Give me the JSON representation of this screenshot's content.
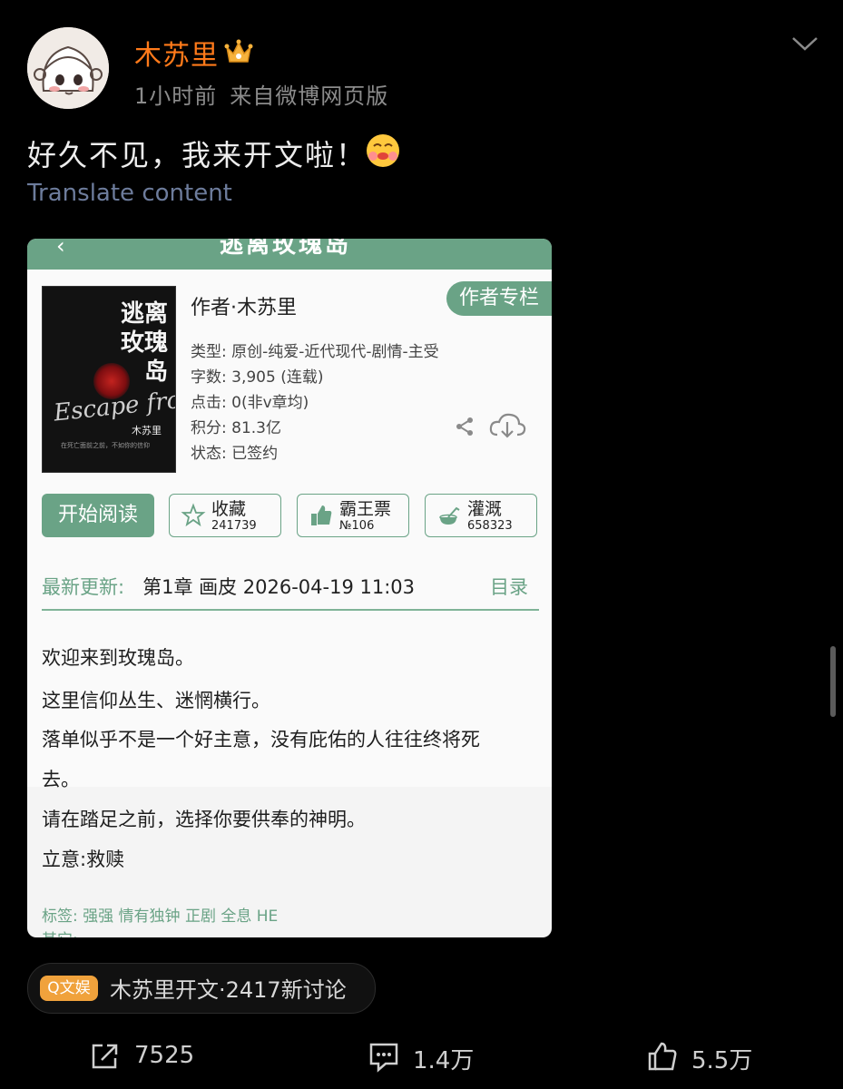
{
  "post": {
    "username": "木苏里",
    "time": "1小时前",
    "source": "来自微博网页版",
    "text": "好久不见，我来开文啦！",
    "translate_label": "Translate content"
  },
  "card": {
    "header_title": "逃离玫瑰岛",
    "cover": {
      "title": "逃离玫瑰岛",
      "script_text": "Escape from",
      "author": "木苏里",
      "tagline": "在死亡面前之前，不如你的信仰"
    },
    "author_line": "作者·木苏里",
    "author_column_button": "作者专栏",
    "details": [
      "类型: 原创-纯爱-近代现代-剧情-主受",
      "字数: 3,905 (连载)",
      "点击: 0(非v章均)",
      "积分: 81.3亿",
      "状态: 已签约"
    ],
    "buttons": {
      "read": "开始阅读",
      "collect": {
        "label": "收藏",
        "count": "241739"
      },
      "vote": {
        "label": "霸王票",
        "count": "№106"
      },
      "irrigate": {
        "label": "灌溉",
        "count": "658323"
      }
    },
    "latest_update": {
      "label": "最新更新:",
      "value": "第1章  画皮  2026-04-19 11:03",
      "catalog": "目录"
    },
    "synopsis": [
      "欢迎来到玫瑰岛。",
      "这里信仰丛生、迷惘横行。",
      "落单似乎不是一个好主意，没有庇佑的人往往终将死",
      "去。",
      "请在踏足之前，选择你要供奉的神明。",
      "立意:救赎"
    ],
    "tags": "标签:  强强  情有独钟  正剧  全息  HE",
    "other": "其它:"
  },
  "topic": {
    "badge": "Q文娱",
    "text": "木苏里开文·2417新讨论"
  },
  "actions": {
    "repost": "7525",
    "comment": "1.4万",
    "like": "5.5万"
  },
  "colors": {
    "username": "#ff7a1a",
    "card_green": "#6aa386",
    "translate": "#6d7c9c",
    "topic_badge": "#f0a23c"
  }
}
